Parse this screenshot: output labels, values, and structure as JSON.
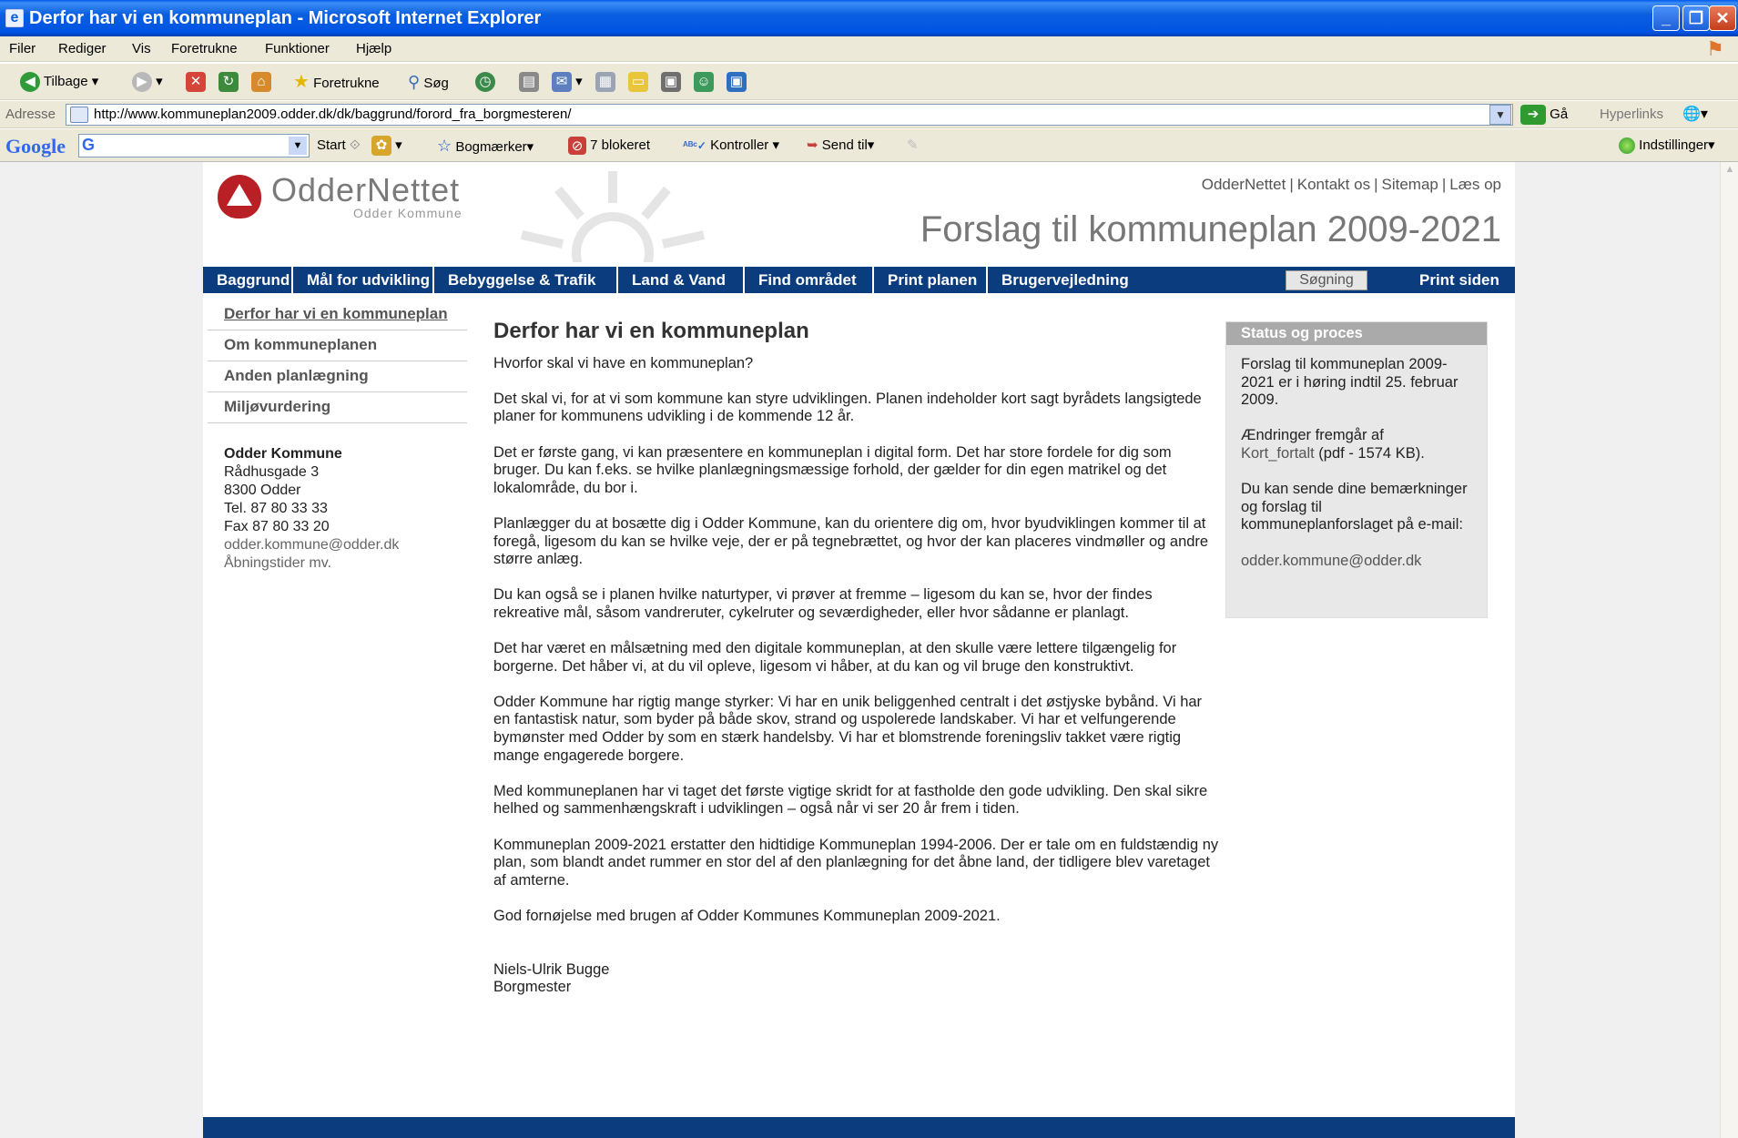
{
  "window": {
    "title": "Derfor har vi en kommuneplan - Microsoft Internet Explorer",
    "minimize": "_",
    "restore": "❐",
    "close": "✕"
  },
  "menu": [
    "Filer",
    "Rediger",
    "Vis",
    "Foretrukne",
    "Funktioner",
    "Hjælp"
  ],
  "toolbar": {
    "back": "Tilbage",
    "favorites": "Foretrukne",
    "search": "Søg"
  },
  "address": {
    "label": "Adresse",
    "url": "http://www.kommuneplan2009.odder.dk/dk/baggrund/forord_fra_borgmesteren/",
    "go": "Gå",
    "links": "Hyperlinks"
  },
  "googlebar": {
    "logo": "Google",
    "start": "Start",
    "bookmarks": "Bogmærker",
    "blocked": "7 blokeret",
    "check": "Kontroller",
    "sendto": "Send til",
    "settings": "Indstillinger"
  },
  "site": {
    "logo": "OdderNettet",
    "logo_sub": "Odder Kommune",
    "toplinks": [
      "OdderNettet",
      "Kontakt os",
      "Sitemap",
      "Læs op"
    ],
    "headline": "Forslag til kommuneplan 2009-2021",
    "nav": [
      "Baggrund",
      "Mål for udvikling",
      "Bebyggelse & Trafik",
      "Land & Vand",
      "Find området",
      "Print planen",
      "Brugervejledning"
    ],
    "search_button": "Søgning",
    "print_page": "Print siden",
    "subnav": [
      "Derfor har vi en kommuneplan",
      "Om kommuneplanen",
      "Anden planlægning",
      "Miljøvurdering"
    ],
    "contact": {
      "name": "Odder Kommune",
      "street": "Rådhusgade 3",
      "city": "8300 Odder",
      "tel": "Tel. 87 80 33 33",
      "fax": "Fax 87 80 33 20",
      "email": "odder.kommune@odder.dk",
      "hours": "Åbningstider mv."
    },
    "article": {
      "title": "Derfor har vi en kommuneplan",
      "paragraphs": [
        "Hvorfor skal vi have en kommuneplan?",
        "Det skal vi, for at vi som kommune kan styre udviklingen. Planen indeholder kort sagt byrådets langsigtede planer for kommunens udvikling i de kommende 12 år.",
        "Det er første gang, vi kan præsentere en kommuneplan i digital form. Det har store fordele for dig som bruger. Du kan f.eks. se hvilke planlægningsmæssige forhold, der gælder for din egen matrikel og det lokalområde, du bor i.",
        "Planlægger du at bosætte dig i Odder Kommune, kan du orientere dig om, hvor byudviklingen kommer til at foregå, ligesom du kan se hvilke veje, der er på tegnebrættet, og hvor der kan placeres vindmøller og andre større anlæg.",
        "Du kan også se i planen hvilke naturtyper, vi prøver at fremme – ligesom du kan se, hvor der findes rekreative mål, såsom vandreruter, cykelruter og seværdigheder, eller hvor sådanne er planlagt.",
        "Det har været en målsætning med den digitale kommuneplan, at den skulle være lettere tilgængelig for borgerne. Det håber vi, at du vil opleve, ligesom vi håber, at du kan og vil bruge den konstruktivt.",
        "Odder Kommune har rigtig mange styrker: Vi har en unik beliggenhed centralt i det østjyske bybånd. Vi har en fantastisk natur, som byder på både skov, strand og uspolerede landskaber. Vi har et velfungerende bymønster med Odder by som en stærk handelsby. Vi har et blomstrende foreningsliv takket være rigtig mange engagerede borgere.",
        "Med kommuneplanen har vi taget det første vigtige skridt for at fastholde den gode udvikling. Den skal sikre helhed og sammenhængskraft i udviklingen – også når vi ser 20 år frem i tiden.",
        "Kommuneplan 2009-2021 erstatter den hidtidige Kommuneplan 1994-2006. Der er tale om en fuldstændig ny plan, som blandt andet rummer en stor del af den planlægning for det åbne land, der tidligere blev varetaget af amterne.",
        "God fornøjelse med brugen af Odder Kommunes Kommuneplan 2009-2021."
      ],
      "signature_name": "Niels-Ulrik Bugge",
      "signature_title": "Borgmester"
    },
    "status": {
      "header": "Status og proces",
      "text1": "Forslag til kommuneplan 2009-2021 er i høring indtil 25. februar 2009.",
      "text2_prefix": "Ændringer fremgår af",
      "text2_link": "Kort_fortalt",
      "text2_suffix": " (pdf - 1574 KB).",
      "text3": "Du kan sende dine bemærkninger og forslag til kommuneplanforslaget på e-mail:",
      "email": "odder.kommune@odder.dk"
    }
  }
}
